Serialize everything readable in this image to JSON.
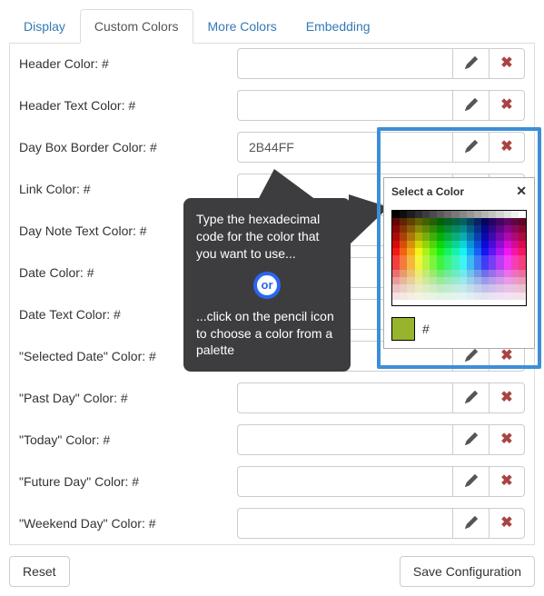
{
  "tabs": [
    {
      "label": "Display",
      "active": false
    },
    {
      "label": "Custom Colors",
      "active": true
    },
    {
      "label": "More Colors",
      "active": false
    },
    {
      "label": "Embedding",
      "active": false
    }
  ],
  "rows": [
    {
      "label": "Header Color: #",
      "value": ""
    },
    {
      "label": "Header Text Color: #",
      "value": ""
    },
    {
      "label": "Day Box Border Color: #",
      "value": "2B44FF"
    },
    {
      "label": "Link Color: #",
      "value": ""
    },
    {
      "label": "Day Note Text Color: #",
      "value": ""
    },
    {
      "label": "Date Color: #",
      "value": ""
    },
    {
      "label": "Date Text Color: #",
      "value": ""
    },
    {
      "label": "\"Selected Date\" Color: #",
      "value": ""
    },
    {
      "label": "\"Past Day\" Color: #",
      "value": ""
    },
    {
      "label": "\"Today\" Color: #",
      "value": ""
    },
    {
      "label": "\"Future Day\" Color: #",
      "value": ""
    },
    {
      "label": "\"Weekend Day\" Color: #",
      "value": ""
    }
  ],
  "footer": {
    "reset": "Reset",
    "save": "Save Configuration"
  },
  "callout": {
    "top": "Type the hexadecimal code for the color that you want to use...",
    "or": "or",
    "bottom": "...click on the pencil icon to choose a color from a palette"
  },
  "picker": {
    "title": "Select a Color",
    "close": "✕",
    "preview_color": "#96b52d",
    "hash": "#"
  },
  "colors": {
    "link": "#337ab7",
    "danger": "#a94442",
    "frame": "#3c8ed8"
  }
}
